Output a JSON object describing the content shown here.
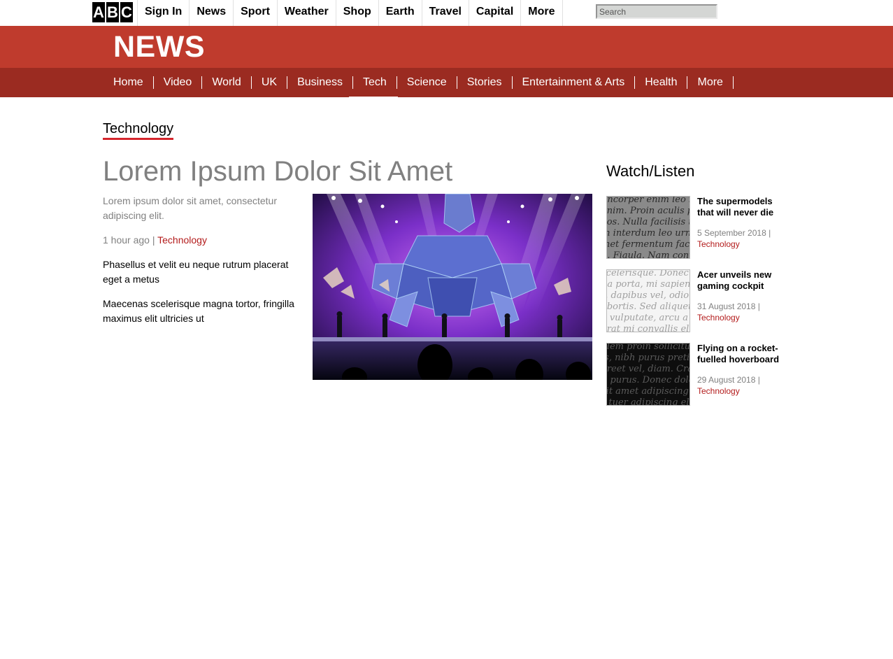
{
  "brand": {
    "letters": [
      "A",
      "B",
      "C"
    ]
  },
  "topnav": {
    "items": [
      "Sign In",
      "News",
      "Sport",
      "Weather",
      "Shop",
      "Earth",
      "Travel",
      "Capital",
      "More"
    ],
    "search_placeholder": "Search"
  },
  "banner": {
    "title": "NEWS"
  },
  "sections": {
    "items": [
      "Home",
      "Video",
      "World",
      "UK",
      "Business",
      "Tech",
      "Science",
      "Stories",
      "Entertainment & Arts",
      "Health",
      "More"
    ],
    "active": "Tech"
  },
  "page": {
    "section_label": "Technology"
  },
  "article": {
    "headline": "Lorem Ipsum Dolor Sit Amet",
    "summary": "Lorem ipsum dolor sit amet, consectetur adipiscing elit.",
    "time": "1 hour ago",
    "separator": " | ",
    "tag": "Technology",
    "paragraphs": [
      "Phasellus et velit eu neque rutrum placerat eget a metus",
      "Maecenas scelerisque magna tortor, fringilla maximus elit ultricies ut"
    ]
  },
  "sidebar": {
    "title": "Watch/Listen",
    "items": [
      {
        "title": "The supermodels that will never die",
        "date": "5 September 2018 |",
        "tag": "Technology",
        "thumb_text": "uncorper enim leo in od\nenim. Proin aculis pulv\neos. Nulla facilisis ten\nin interdum leo urna no\nmet fermentum facilisis\nn. Fiaula. Nam convall",
        "thumb_bg": "#8a8a8a",
        "thumb_fg": "#2a2a2a"
      },
      {
        "title": "Acer unveils new gaming cockpit",
        "date": "31 August 2018 |",
        "tag": "Technology",
        "thumb_text": "scelerisque. Donec vel\nda porta, mi sapien fri\nt, dapibus vel, odio. Fus\nobortis. Sed aliquet, elit\ne vulputate, arcu a mol\nerat mi convallis elit",
        "thumb_bg": "#f4f4f4",
        "thumb_fg": "#a0a0a0"
      },
      {
        "title": "Flying on a rocket-fuelled hoverboard",
        "date": "29 August 2018 |",
        "tag": "Technology",
        "thumb_text": "olem proin sollicitudin, mi\nis, nibh purus pretium\noreet vel, diam. Cras be\nd purus. Donec dolor e\nsit amet adipiscing fa\nr tuer adipiscing elit. Pr",
        "thumb_bg": "#0e0e0e",
        "thumb_fg": "#5a5a5a"
      }
    ]
  },
  "colors": {
    "banner": "#bf3b2d",
    "section_nav": "#9b2b21",
    "accent_red": "#b31b1b",
    "headline_gray": "#808080"
  }
}
